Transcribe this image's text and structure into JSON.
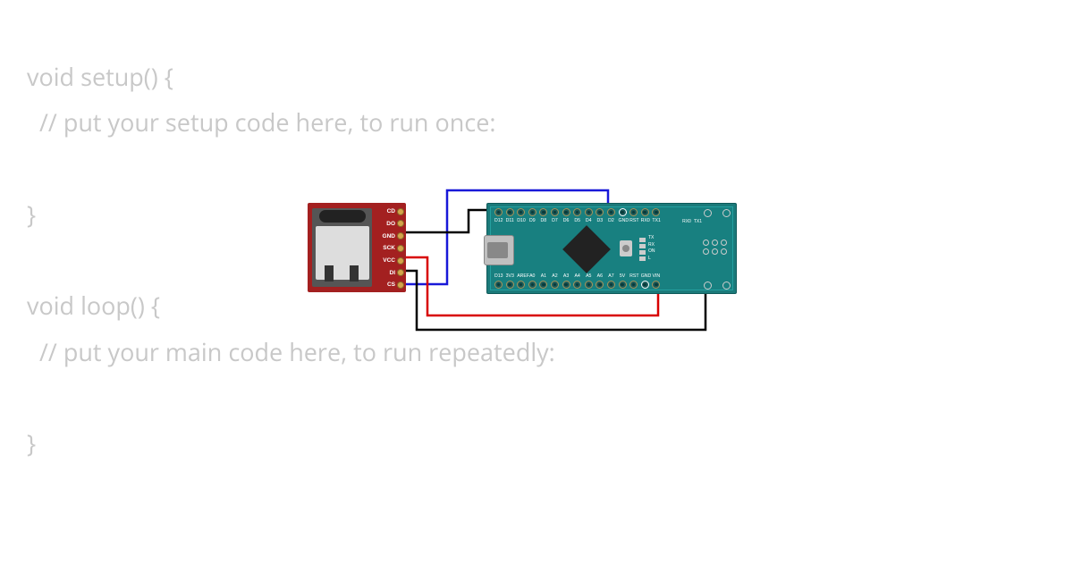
{
  "code": {
    "lines": [
      "void setup() {",
      "  // put your setup code here, to run once:",
      "",
      "}",
      "",
      "void loop() {",
      "  // put your main code here, to run repeatedly:",
      "",
      "}"
    ]
  },
  "sd_module": {
    "pins": [
      "CD",
      "DO",
      "GND",
      "SCK",
      "VCC",
      "DI",
      "CS"
    ]
  },
  "nano": {
    "top_pins": [
      "D12",
      "D11",
      "D10",
      "D9",
      "D8",
      "D7",
      "D6",
      "D5",
      "D4",
      "D3",
      "D2",
      "GND",
      "RST",
      "RX0",
      "TX1"
    ],
    "bottom_pins": [
      "D13",
      "3V3",
      "AREF",
      "A0",
      "A1",
      "A2",
      "A3",
      "A4",
      "A5",
      "A6",
      "A7",
      "5V",
      "RST",
      "GND",
      "VIN"
    ],
    "led_labels": [
      "TX",
      "RX",
      "ON",
      "L"
    ],
    "rx_tx": [
      "RX0",
      "TX1"
    ]
  },
  "wires": [
    {
      "name": "wire-gnd-top",
      "color": "#000",
      "from": "sd.GND",
      "to": "nano.top.GND"
    },
    {
      "name": "wire-cs-blue",
      "color": "#1818d8",
      "from": "sd.CS",
      "to": "nano.top.D3"
    },
    {
      "name": "wire-vcc-red",
      "color": "#d80000",
      "from": "sd.VCC",
      "to": "nano.bottom.5V"
    },
    {
      "name": "wire-gnd-bottom",
      "color": "#000",
      "from": "sd.DI-area",
      "to": "nano.bottom.GND"
    }
  ]
}
